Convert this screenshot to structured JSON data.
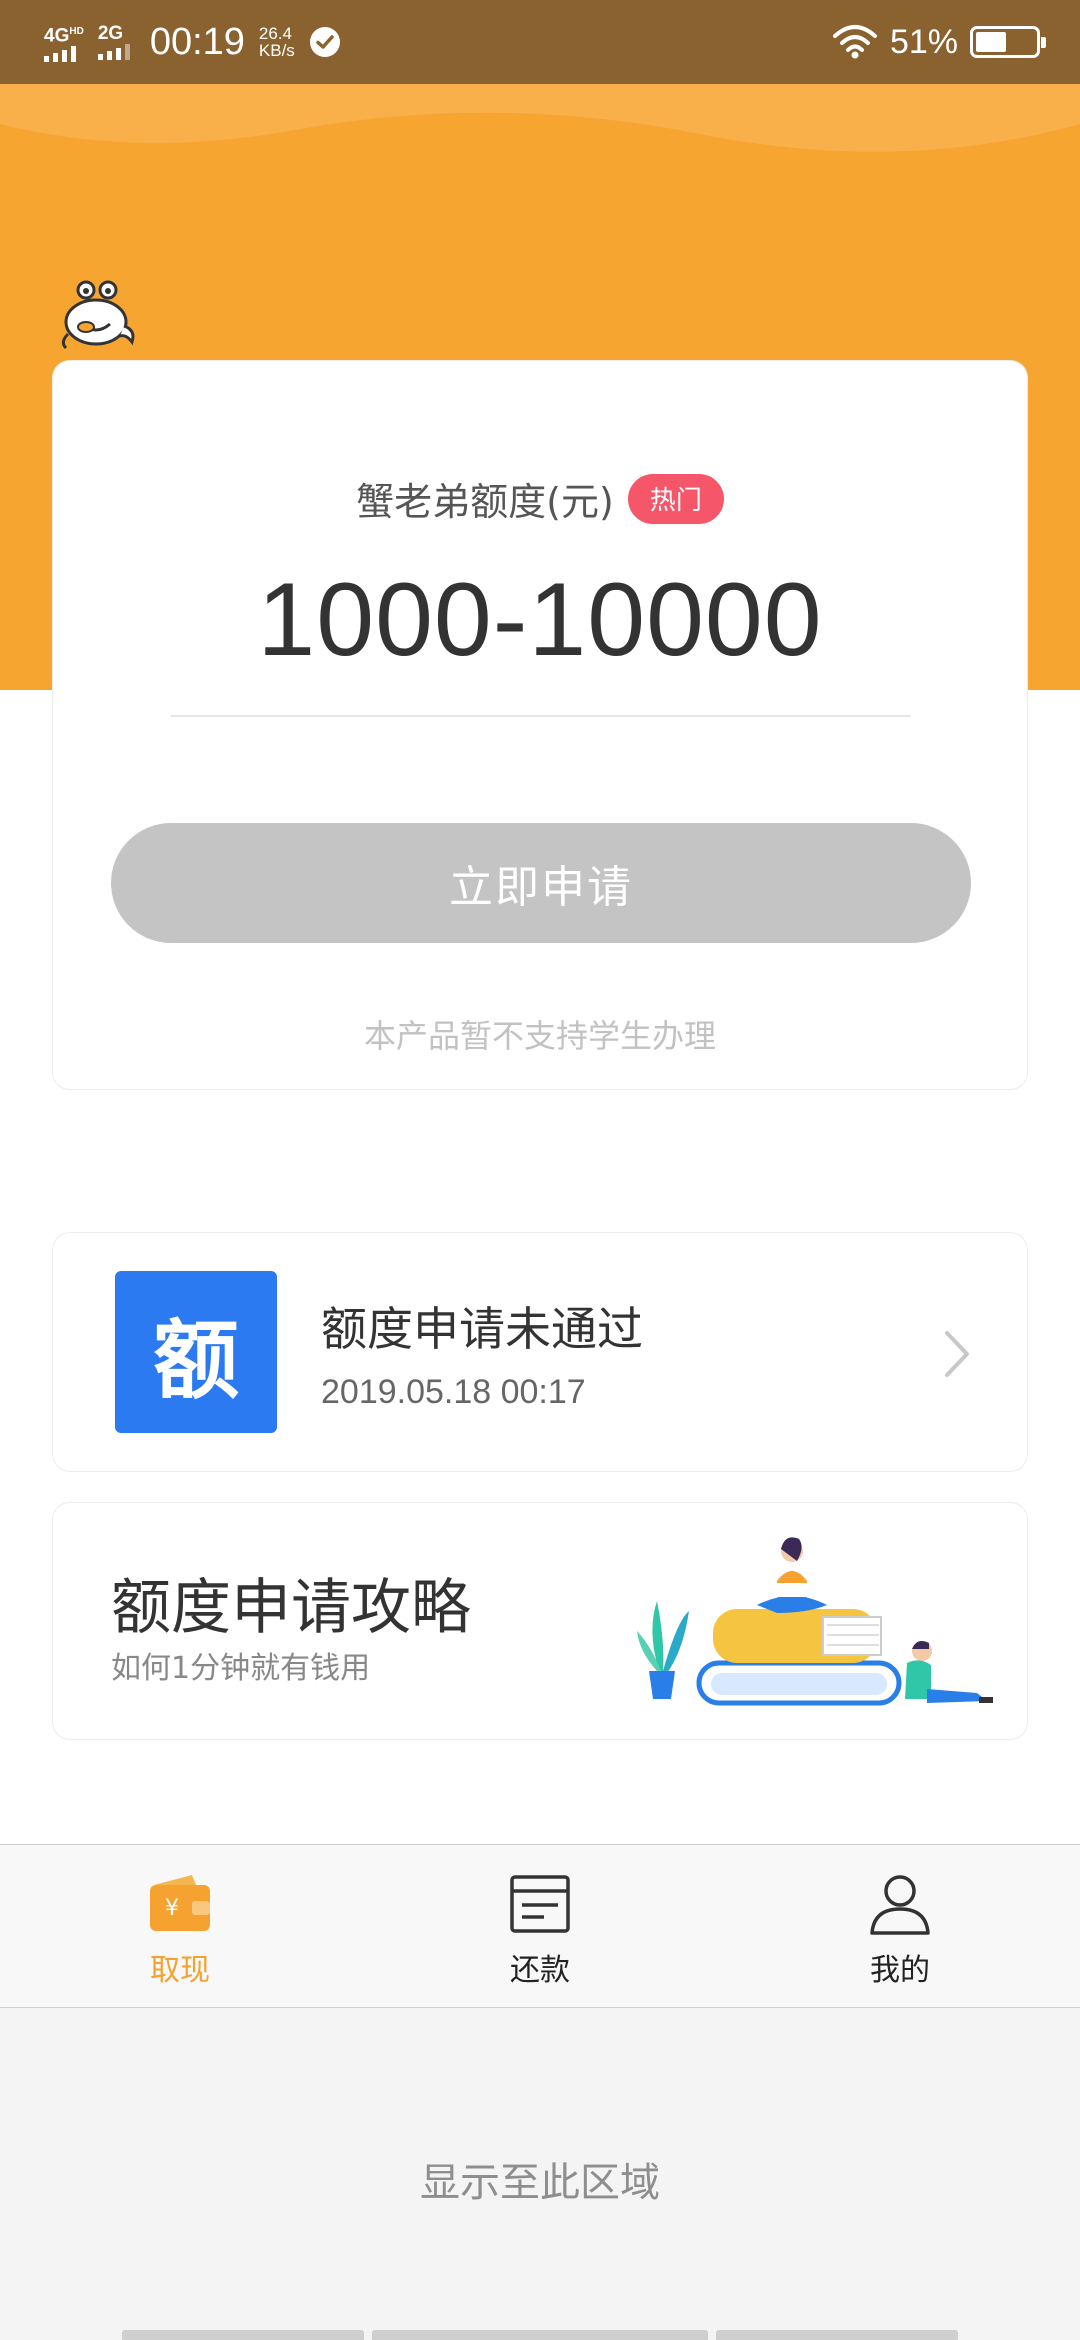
{
  "status_bar": {
    "network_1": "4G",
    "network_1_sup": "HD",
    "network_2": "2G",
    "time": "00:19",
    "speed_value": "26.4",
    "speed_unit": "KB/s",
    "battery_percent": "51%",
    "battery_level": 0.51
  },
  "header": {
    "logo_icon": "crab-logo-icon",
    "brand_color": "#f7a531"
  },
  "quota_card": {
    "label": "蟹老弟额度(元)",
    "badge": "热门",
    "amount_range": "1000-10000",
    "apply_button": "立即申请",
    "note": "本产品暂不支持学生办理"
  },
  "record": {
    "icon_text": "额",
    "title": "额度申请未通过",
    "date": "2019.05.18 00:17"
  },
  "strategy": {
    "title": "额度申请攻略",
    "subtitle": "如何1分钟就有钱用"
  },
  "bottom_nav": {
    "items": [
      {
        "label": "取现",
        "icon": "wallet-icon",
        "active": true
      },
      {
        "label": "还款",
        "icon": "bill-icon",
        "active": false
      },
      {
        "label": "我的",
        "icon": "person-icon",
        "active": false
      }
    ]
  },
  "display_note": "显示至此区域"
}
